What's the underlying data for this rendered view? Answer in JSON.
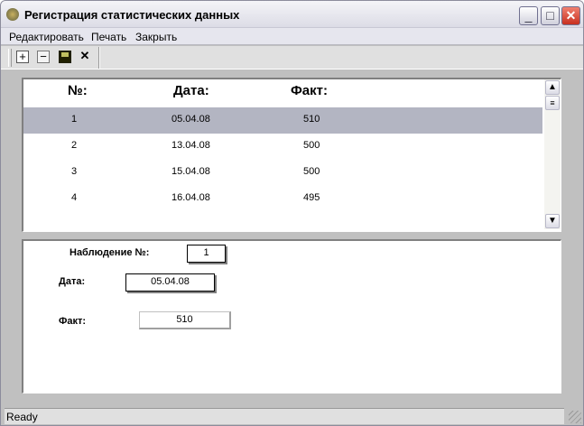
{
  "window": {
    "title": "Регистрация статистических данных"
  },
  "menu": [
    "Редактировать",
    "Печать",
    "Закрыть"
  ],
  "toolbar": {
    "add": "+",
    "remove": "−",
    "delete": "✕"
  },
  "table": {
    "headers": [
      "№:",
      "Дата:",
      "Факт:"
    ],
    "rows": [
      {
        "n": "1",
        "date": "05.04.08",
        "fact": "510"
      },
      {
        "n": "2",
        "date": "13.04.08",
        "fact": "500"
      },
      {
        "n": "3",
        "date": "15.04.08",
        "fact": "500"
      },
      {
        "n": "4",
        "date": "16.04.08",
        "fact": "495"
      }
    ],
    "selected_index": 0
  },
  "form": {
    "obs_label": "Наблюдение №:",
    "obs_value": "1",
    "date_label": "Дата:",
    "date_value": "05.04.08",
    "fact_label": "Факт:",
    "fact_value": "510"
  },
  "status": "Ready"
}
